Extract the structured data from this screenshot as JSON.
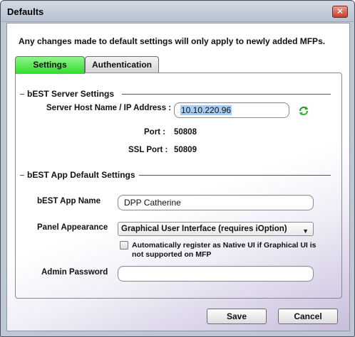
{
  "window": {
    "title": "Defaults",
    "close_label": "✕"
  },
  "notice": "Any changes made to default settings will only apply to newly added MFPs.",
  "tabs": [
    {
      "label": "Settings",
      "active": true
    },
    {
      "label": "Authentication",
      "active": false
    }
  ],
  "server_section": {
    "title": "bEST Server Settings",
    "host_label": "Server Host Name / IP Address :",
    "host_value": "10.10.220.96",
    "port_label": "Port :",
    "port_value": "50808",
    "ssl_port_label": "SSL Port :",
    "ssl_port_value": "50809",
    "refresh_icon": "refresh-icon"
  },
  "app_section": {
    "title": "bEST App Default Settings",
    "app_name_label": "bEST App Name",
    "app_name_value": "DPP Catherine",
    "panel_label": "Panel Appearance",
    "panel_value": "Graphical User Interface (requires iOption)",
    "native_checkbox_label": "Automatically register as Native UI if Graphical UI is not supported on MFP",
    "native_checkbox_checked": false,
    "admin_password_label": "Admin Password",
    "admin_password_value": ""
  },
  "buttons": {
    "save": "Save",
    "cancel": "Cancel"
  },
  "colors": {
    "active_tab": "#2fdc2a",
    "selection": "#a8cdf2",
    "close": "#c4402b"
  }
}
